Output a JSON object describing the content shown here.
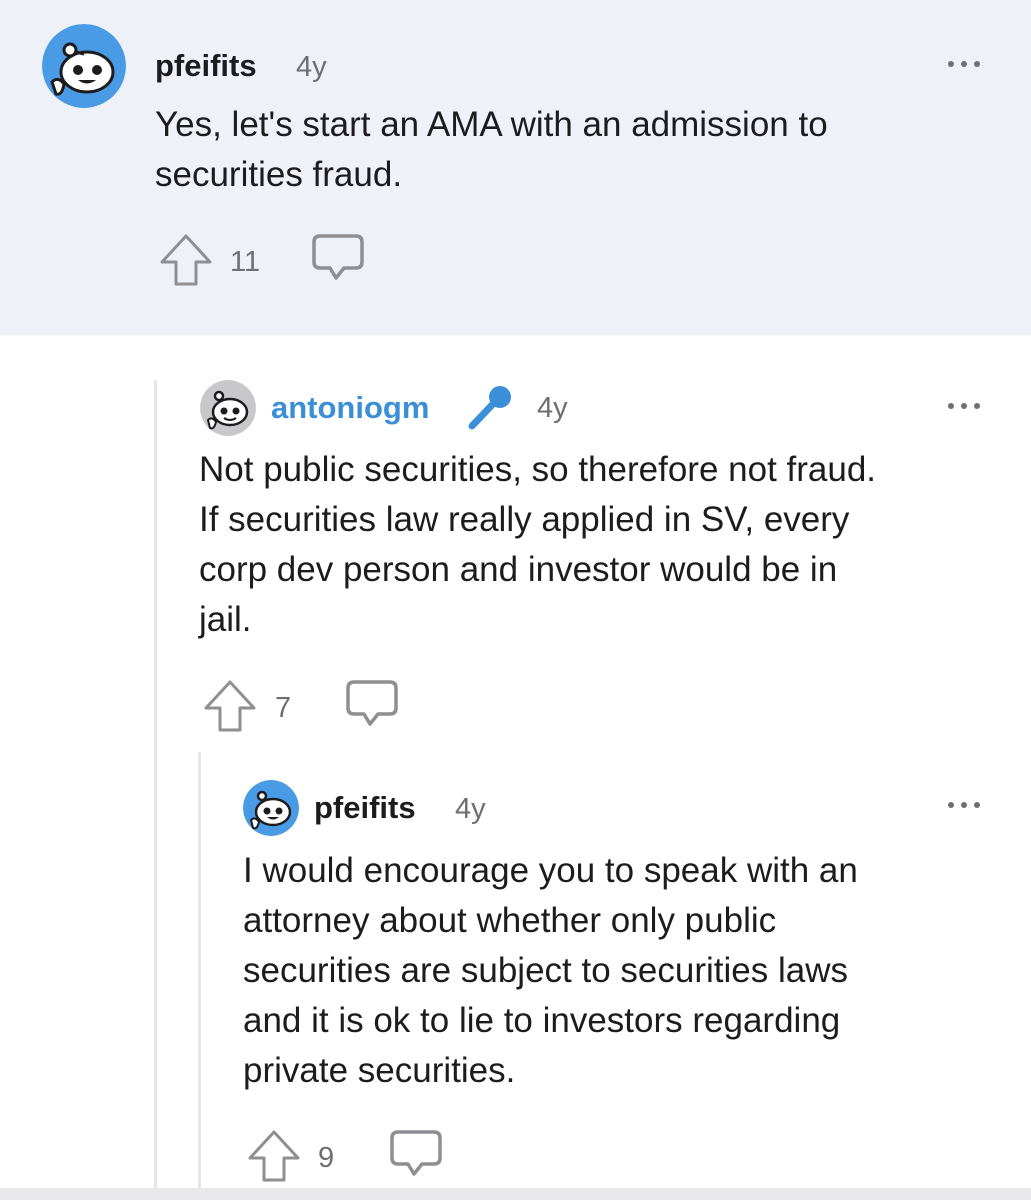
{
  "colors": {
    "highlight_bg": "#eef2f8",
    "op_link": "#3b8fd9",
    "muted": "#6e6e73",
    "icon_gray": "#8e8e93"
  },
  "comments": [
    {
      "username": "pfeifits",
      "time": "4y",
      "body": "Yes, let's start an AMA with an admission to\nsecurities fraud.",
      "score": "11",
      "avatar": "snoo-avatar-icon"
    },
    {
      "username": "antoniogm",
      "flair_icon": "microphone-icon",
      "time": "4y",
      "body": "Not public securities, so therefore not fraud.\nIf securities law really applied in SV, every\ncorp dev person and investor would be in\njail.",
      "score": "7",
      "avatar": "snoo-avatar-gray-icon"
    },
    {
      "username": "pfeifits",
      "time": "4y",
      "body": "I would encourage you to speak with an\nattorney about whether only public\nsecurities are subject to securities laws\nand it is ok to lie to investors regarding\nprivate securities.",
      "score": "9",
      "avatar": "snoo-avatar-icon"
    }
  ]
}
